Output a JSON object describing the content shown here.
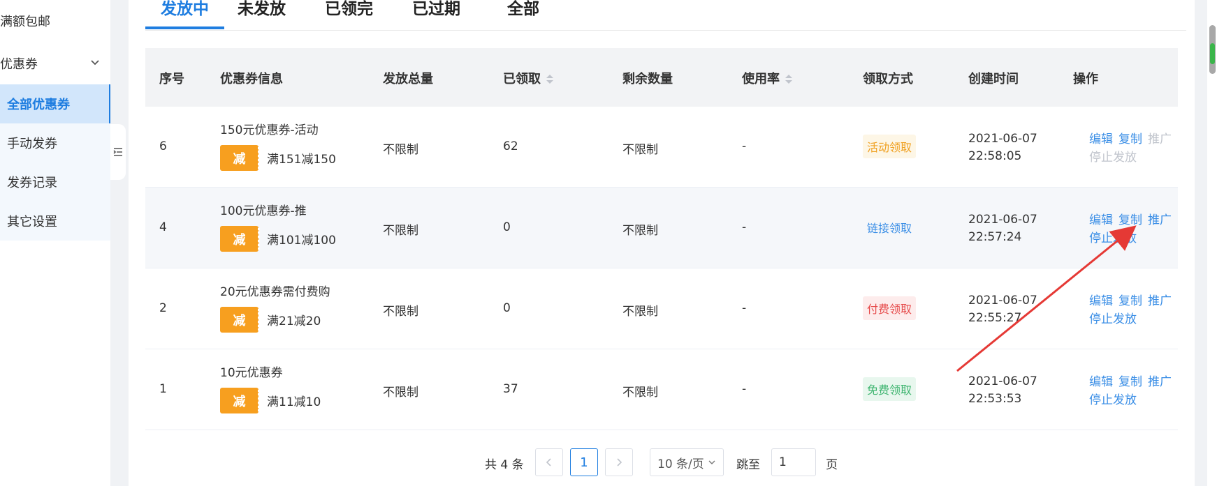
{
  "sidebar": {
    "items": [
      {
        "label": "满额包邮"
      },
      {
        "label": "优惠券"
      },
      {
        "label": "全部优惠券"
      },
      {
        "label": "手动发券"
      },
      {
        "label": "发券记录"
      },
      {
        "label": "其它设置"
      }
    ]
  },
  "tabs": [
    "发放中",
    "未发放",
    "已领完",
    "已过期",
    "全部"
  ],
  "table": {
    "headers": [
      "序号",
      "优惠券信息",
      "发放总量",
      "已领取",
      "剩余数量",
      "使用率",
      "领取方式",
      "创建时间",
      "操作"
    ],
    "badge": "减",
    "rows": [
      {
        "id": "6",
        "name": "150元优惠券-活动",
        "rule": "满151减150",
        "total": "不限制",
        "claimed": "62",
        "remaining": "不限制",
        "usage": "-",
        "method": "活动领取",
        "method_color": "#f0a020",
        "method_bg": "#fdf6e6",
        "date": "2021-06-07",
        "time": "22:58:05",
        "op_edit": "编辑",
        "op_copy": "复制",
        "op_promote": "推广",
        "op_stop": "停止发放",
        "promote_disabled": true,
        "stop_disabled": true
      },
      {
        "id": "4",
        "name": "100元优惠券-推",
        "rule": "满101减100",
        "total": "不限制",
        "claimed": "0",
        "remaining": "不限制",
        "usage": "-",
        "method": "链接领取",
        "method_color": "#3a8ee6",
        "method_bg": "#f5f7fa",
        "date": "2021-06-07",
        "time": "22:57:24",
        "op_edit": "编辑",
        "op_copy": "复制",
        "op_promote": "推广",
        "op_stop": "停止发放",
        "promote_disabled": false,
        "stop_disabled": false
      },
      {
        "id": "2",
        "name": "20元优惠券需付费购",
        "rule": "满21减20",
        "total": "不限制",
        "claimed": "0",
        "remaining": "不限制",
        "usage": "-",
        "method": "付费领取",
        "method_color": "#e64a4a",
        "method_bg": "#fdecec",
        "date": "2021-06-07",
        "time": "22:55:27",
        "op_edit": "编辑",
        "op_copy": "复制",
        "op_promote": "推广",
        "op_stop": "停止发放",
        "promote_disabled": false,
        "stop_disabled": false
      },
      {
        "id": "1",
        "name": "10元优惠券",
        "rule": "满11减10",
        "total": "不限制",
        "claimed": "37",
        "remaining": "不限制",
        "usage": "-",
        "method": "免费领取",
        "method_color": "#3cb46e",
        "method_bg": "#e8f7ee",
        "date": "2021-06-07",
        "time": "22:53:53",
        "op_edit": "编辑",
        "op_copy": "复制",
        "op_promote": "推广",
        "op_stop": "停止发放",
        "promote_disabled": false,
        "stop_disabled": false
      }
    ]
  },
  "pagination": {
    "total_text": "共 4 条",
    "current_page": "1",
    "page_size": "10 条/页",
    "jump_label": "跳至",
    "jump_value": "1",
    "page_suffix": "页"
  },
  "colors": {
    "accent": "#1e7de0",
    "annotation_arrow": "#e53935"
  }
}
